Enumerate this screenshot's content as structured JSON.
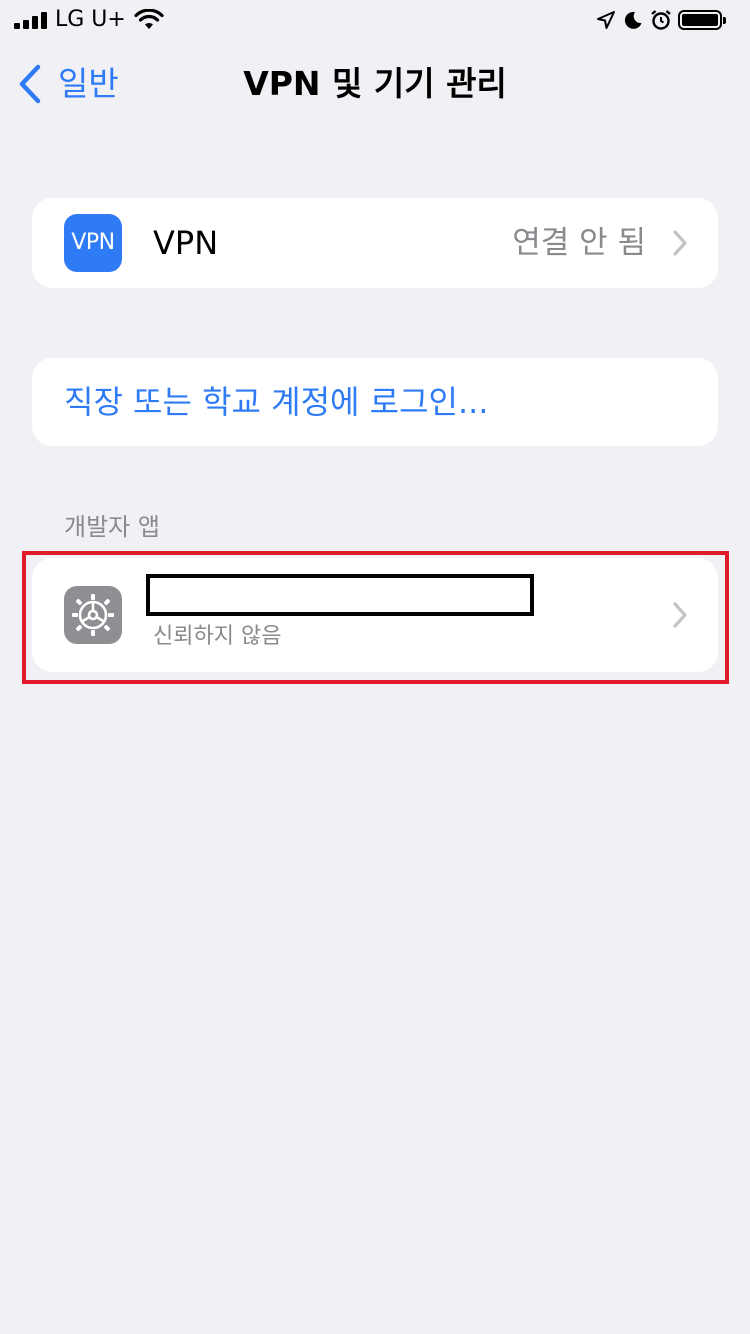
{
  "status_bar": {
    "carrier": "LG U+",
    "icons": [
      "signal-icon",
      "wifi-icon",
      "location-icon",
      "moon-icon",
      "alarm-icon",
      "battery-icon"
    ]
  },
  "nav": {
    "back_label": "일반",
    "title": "VPN 및 기기 관리"
  },
  "vpn_row": {
    "icon_text": "VPN",
    "label": "VPN",
    "status": "연결 안 됨"
  },
  "login_row": {
    "label": "직장 또는 학교 계정에 로그인..."
  },
  "developer_section": {
    "header": "개발자 앱",
    "app": {
      "subtitle": "신뢰하지 않음"
    }
  },
  "colors": {
    "accent": "#2f7bf5",
    "background": "#f0f0f5",
    "secondary_text": "#8a8a8e",
    "highlight": "#e01c2b",
    "gear_tile": "#8e8e93"
  }
}
